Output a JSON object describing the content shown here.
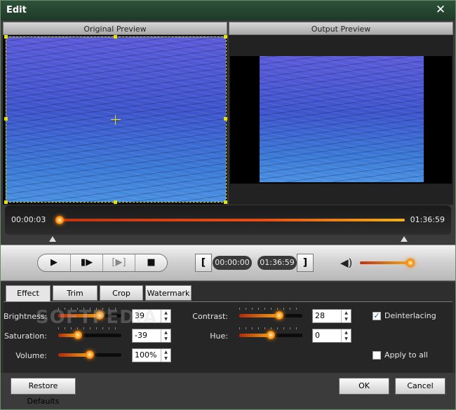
{
  "window": {
    "title": "Edit"
  },
  "preview": {
    "original_label": "Original Preview",
    "output_label": "Output Preview"
  },
  "timeline": {
    "current_time": "00:00:03",
    "end_time": "01:36:59",
    "progress": 0.0
  },
  "trim": {
    "start_time": "00:00:00",
    "end_time": "01:36:59"
  },
  "volume": {
    "level": 0.95
  },
  "tabs": [
    {
      "label": "Effect"
    },
    {
      "label": "Trim"
    },
    {
      "label": "Crop"
    },
    {
      "label": "Watermark"
    }
  ],
  "effect": {
    "brightness": {
      "label": "Brightness:",
      "value": "39",
      "level": 0.66
    },
    "saturation": {
      "label": "Saturation:",
      "value": "-39",
      "level": 0.31
    },
    "volume": {
      "label": "Volume:",
      "value": "100%",
      "level": 0.5
    },
    "contrast": {
      "label": "Contrast:",
      "value": "28",
      "level": 0.63
    },
    "hue": {
      "label": "Hue:",
      "value": "0",
      "level": 0.5
    },
    "deinterlacing": {
      "label": "Deinterlacing",
      "checked": true
    },
    "apply_to_all": {
      "label": "Apply to all",
      "checked": false
    }
  },
  "watermark_text": "SOFTPEDIA",
  "buttons": {
    "restore": "Restore Defaults",
    "ok": "OK",
    "cancel": "Cancel"
  }
}
